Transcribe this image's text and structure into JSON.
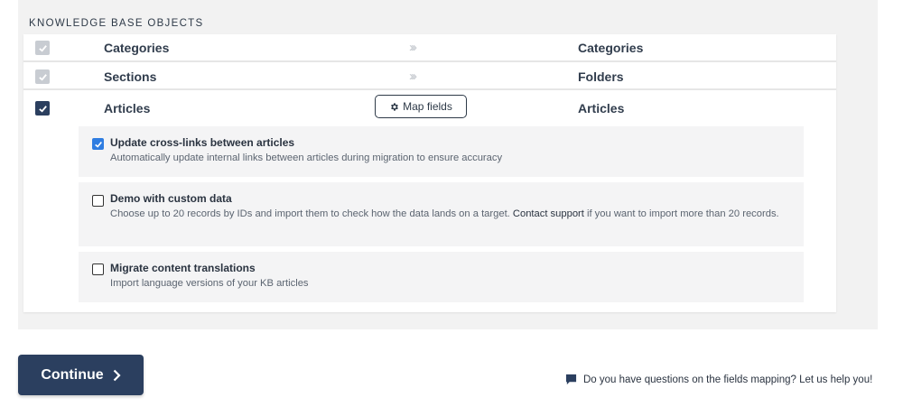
{
  "section": {
    "title": "KNOWLEDGE BASE OBJECTS"
  },
  "objects": [
    {
      "source": "Categories",
      "target": "Categories",
      "arrows": "›››",
      "checked": true,
      "locked": true
    },
    {
      "source": "Sections",
      "target": "Folders",
      "arrows": "›››",
      "checked": true,
      "locked": true
    },
    {
      "source": "Articles",
      "target": "Articles",
      "checked": true,
      "locked": false,
      "map_button": "Map fields"
    }
  ],
  "options": [
    {
      "title": "Update cross-links between articles",
      "description": "Automatically update internal links between articles during migration to ensure accuracy",
      "checked": true
    },
    {
      "title": "Demo with custom data",
      "description_before": "Choose up to 20 records by IDs and import them to check how the data lands on a target. ",
      "description_link": "Contact support",
      "description_after": " if you want to import more than 20 records.",
      "checked": false
    },
    {
      "title": "Migrate content translations",
      "description": "Import language versions of your KB articles",
      "checked": false
    }
  ],
  "footer": {
    "continue_label": "Continue",
    "help_text": "Do you have questions on the fields mapping? Let us help you!"
  },
  "colors": {
    "primary": "#2b3f5f",
    "checkbox_blue": "#2f7de1",
    "disabled_checkbox": "#c8ccd2",
    "panel_bg": "#f2f2f2"
  }
}
